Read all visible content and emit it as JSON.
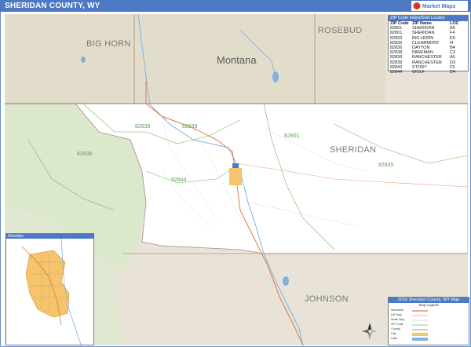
{
  "title": "SHERIDAN COUNTY, WY",
  "logo": {
    "text": "Market Maps",
    "colors": [
      "#d9342b",
      "#4d78c4"
    ]
  },
  "region_labels": {
    "big_horn": "BIG HORN",
    "rosebud": "ROSEBUD",
    "montana": "Montana",
    "sheridan": "SHERIDAN",
    "johnson": "JOHNSON"
  },
  "zip_labels": [
    "82839",
    "82838",
    "82801",
    "82836",
    "82844",
    "82835"
  ],
  "zip_table": {
    "title": "ZIP Code Index/Grid Locator",
    "headers": [
      "ZIP Code",
      "ZIP Name",
      "LOC"
    ],
    "rows": [
      [
        "82801",
        "SHERIDAN",
        "A6"
      ],
      [
        "82801",
        "SHERIDAN",
        "F4"
      ],
      [
        "82833",
        "BIG HORN",
        "E5"
      ],
      [
        "82835",
        "CLEARMONT",
        "I4"
      ],
      [
        "82836",
        "DAYTON",
        "B4"
      ],
      [
        "82838",
        "PARKMAN",
        "C3"
      ],
      [
        "82839",
        "RANCHESTER",
        "A6"
      ],
      [
        "82839",
        "RANCHESTER",
        "D3"
      ],
      [
        "82842",
        "STORY",
        "F5"
      ],
      [
        "82844",
        "WOLF",
        "D4"
      ]
    ]
  },
  "inset": {
    "title": "Sheridan"
  },
  "legend": {
    "title": "2016 Sheridan County, WY Map",
    "subtitle": "Map Legend",
    "items": [
      "Interstate",
      "US Hwy",
      "State Hwy",
      "ZIP Code",
      "County",
      "City",
      "Lake"
    ]
  },
  "colors": {
    "county_fill": "#ffffff",
    "outside_fill": "#e8e3d6",
    "park_fill": "#dbe8cc",
    "city_fill": "#f6c46a",
    "water": "#7fb2e0",
    "zip_line": "#6abf5b",
    "title_bar": "#4d78c4"
  }
}
